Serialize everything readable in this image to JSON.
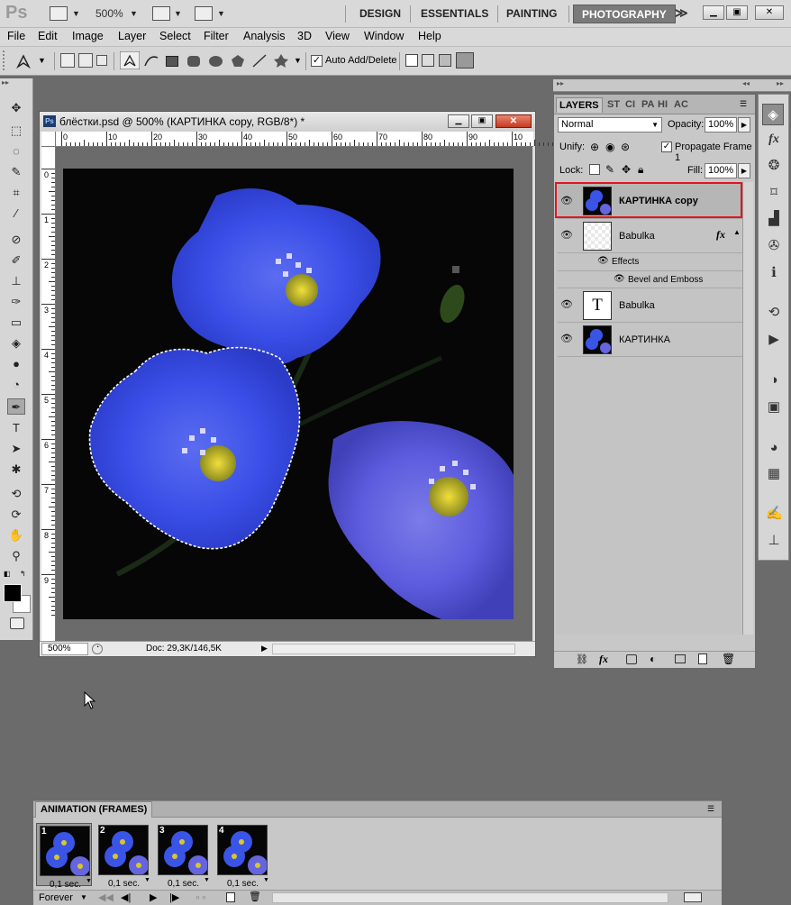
{
  "app": {
    "logo": "Ps",
    "zoom": "500%",
    "workspaces": [
      "DESIGN",
      "ESSENTIALS",
      "PAINTING",
      "PHOTOGRAPHY"
    ],
    "active_workspace": "PHOTOGRAPHY",
    "more_label": "≫"
  },
  "menu": [
    "File",
    "Edit",
    "Image",
    "Layer",
    "Select",
    "Filter",
    "Analysis",
    "3D",
    "View",
    "Window",
    "Help"
  ],
  "options": {
    "auto_add_delete_label": "Auto Add/Delete",
    "auto_add_delete_checked": true
  },
  "document": {
    "title": "блёстки.psd @ 500% (КАРТИНКА copy, RGB/8*) *",
    "zoom": "500%",
    "doc_info": "Doc: 29,3K/146,5K",
    "ruler_top": [
      "0",
      "10",
      "20",
      "30",
      "40",
      "50",
      "60",
      "70",
      "80",
      "90",
      "10"
    ],
    "ruler_left": [
      "0",
      "1",
      "2",
      "3",
      "4",
      "5",
      "6",
      "7",
      "8",
      "9"
    ]
  },
  "layers_panel": {
    "tabs": [
      "LAYERS",
      "ST",
      "CI",
      "PA",
      "HI",
      "AC"
    ],
    "blend_mode": "Normal",
    "opacity_label": "Opacity:",
    "opacity": "100%",
    "unify_label": "Unify:",
    "propagate_label": "Propagate Frame 1",
    "propagate_checked": true,
    "lock_label": "Lock:",
    "fill_label": "Fill:",
    "fill": "100%",
    "layers": [
      {
        "name": "КАРТИНКА copy",
        "type": "image",
        "visible": true,
        "selected": true
      },
      {
        "name": "Babulka",
        "type": "transparent",
        "visible": true,
        "fx": "fx",
        "effects_label": "Effects",
        "effect": "Bevel and Emboss"
      },
      {
        "name": "Babulka",
        "type": "text",
        "visible": true,
        "thumb_glyph": "T"
      },
      {
        "name": "КАРТИНКА",
        "type": "image",
        "visible": true
      }
    ],
    "highlight_color": "#e0161d"
  },
  "animation": {
    "title": "ANIMATION (FRAMES)",
    "frames": [
      {
        "num": "1",
        "delay": "0,1 sec."
      },
      {
        "num": "2",
        "delay": "0,1 sec."
      },
      {
        "num": "3",
        "delay": "0,1 sec."
      },
      {
        "num": "4",
        "delay": "0,1 sec."
      }
    ],
    "loop": "Forever"
  },
  "colors": {
    "flower_blue": "#3a54e6",
    "flower_center": "#d9c62a",
    "background": "#050605"
  }
}
